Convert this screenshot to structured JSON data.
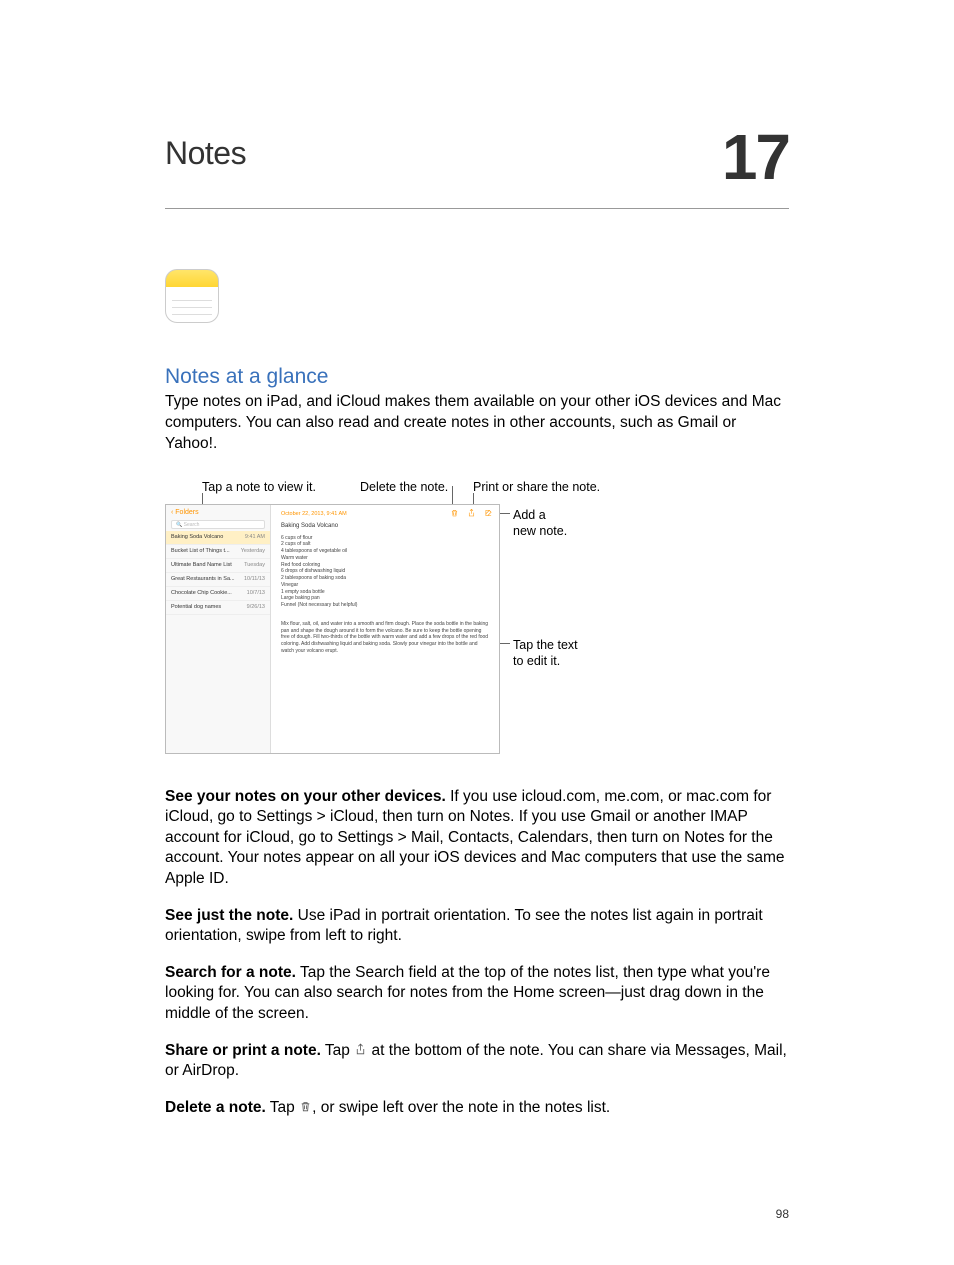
{
  "chapter": {
    "title": "Notes",
    "number": "17"
  },
  "section_heading": "Notes at a glance",
  "intro": "Type notes on iPad, and iCloud makes them available on your other iOS devices and Mac computers. You can also read and create notes in other accounts, such as Gmail or Yahoo!.",
  "callouts": {
    "tap_note": "Tap a note to view it.",
    "delete": "Delete the note.",
    "share": "Print or share the note.",
    "add": "Add a\nnew note.",
    "tap_text": "Tap the text\nto edit it."
  },
  "ipad": {
    "back": "Folders",
    "search_placeholder": "Search",
    "list": [
      {
        "title": "Baking Soda Volcano",
        "date": "9:41 AM",
        "selected": true
      },
      {
        "title": "Bucket List of Things t...",
        "date": "Yesterday"
      },
      {
        "title": "Ultimate Band Name List",
        "date": "Tuesday"
      },
      {
        "title": "Great Restaurants in Sa...",
        "date": "10/11/13"
      },
      {
        "title": "Chocolate Chip Cookie...",
        "date": "10/7/13"
      },
      {
        "title": "Potential dog names",
        "date": "9/26/13"
      }
    ],
    "note_date": "October 22, 2013, 9:41 AM",
    "note_title": "Baking Soda Volcano",
    "note_body": "6 cups of flour\n2 cups of salt\n4 tablespoons of vegetable oil\nWarm water\nRed food coloring\n6 drops of dishwashing liquid\n2 tablespoons of baking soda\nVinegar\n1 empty soda bottle\nLarge baking pan\nFunnel (Not necessary but helpful)",
    "note_para": "Mix flour, salt, oil, and water into a smooth and firm dough.  Place the soda bottle in the baking pan and shape the dough around it to form the volcano.  Be sure to keep the bottle opening free of dough.  Fill two-thirds of the bottle with warm water and add a few drops of the red food coloring. Add dishwashing liquid and baking soda. Slowly pour vinegar into the bottle and watch your volcano erupt."
  },
  "paras": {
    "p1_bold": "See your notes on your other devices.",
    "p1_text": " If you use icloud.com, me.com, or mac.com for iCloud, go to Settings > iCloud, then turn on Notes. If you use Gmail or another IMAP account for iCloud, go to Settings > Mail, Contacts, Calendars, then turn on Notes for the account. Your notes appear on all your iOS devices and Mac computers that use the same Apple ID.",
    "p2_bold": "See just the note.",
    "p2_text": " Use iPad in portrait orientation. To see the notes list again in portrait orientation, swipe from left to right.",
    "p3_bold": "Search for a note.",
    "p3_text": " Tap the Search field at the top of the notes list, then type what you're looking for. You can also search for notes from the Home screen—just drag down in the middle of the screen.",
    "p4_bold": "Share or print a note.",
    "p4_text_a": " Tap ",
    "p4_text_b": " at the bottom of the note. You can share via Messages, Mail, or AirDrop.",
    "p5_bold": "Delete a note.",
    "p5_text_a": " Tap ",
    "p5_text_b": ", or swipe left over the note in the notes list."
  },
  "page_number": "98"
}
